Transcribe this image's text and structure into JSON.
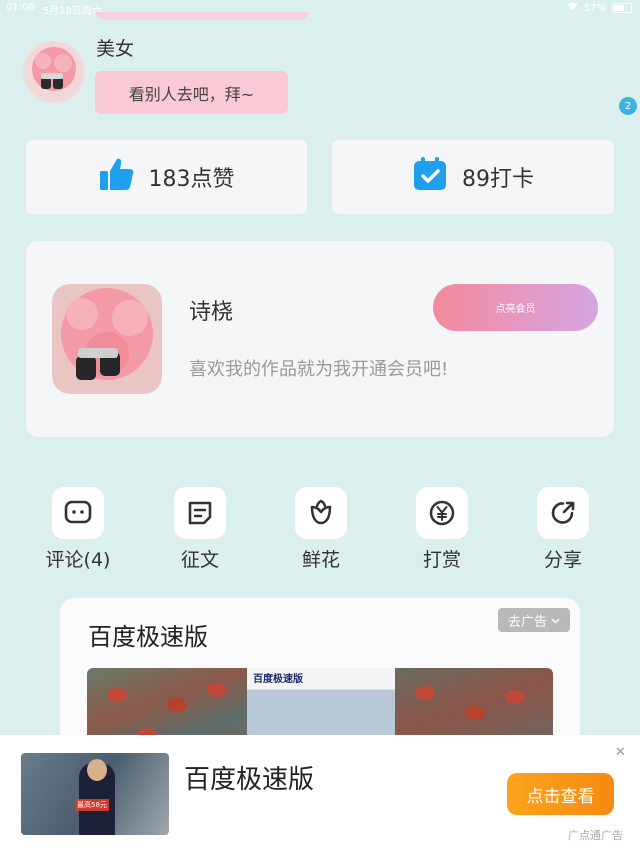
{
  "status_bar": {
    "time": "01:08",
    "date": "5月18日周六",
    "battery": "57%"
  },
  "comment": {
    "username": "美女",
    "message": "看别人去吧，拜~",
    "badge_count": "2"
  },
  "stats": {
    "likes": "183点赞",
    "checkins": "89打卡"
  },
  "vip_card": {
    "name": "诗桡",
    "description": "喜欢我的作品就为我开通会员吧!",
    "button_label": "点亮会员"
  },
  "actions": [
    {
      "label": "评论(4)",
      "icon": "comment-icon"
    },
    {
      "label": "征文",
      "icon": "essay-icon"
    },
    {
      "label": "鲜花",
      "icon": "flower-icon"
    },
    {
      "label": "打赏",
      "icon": "yen-icon"
    },
    {
      "label": "分享",
      "icon": "share-icon"
    }
  ],
  "ad_card": {
    "title": "百度极速版",
    "remove_label": "去广告",
    "image_brand": "百度极速版"
  },
  "bottom_banner": {
    "title": "百度极速版",
    "button_label": "点击查看",
    "source": "广点通广告",
    "thumb_tag": "最高58元"
  },
  "colors": {
    "background": "#dcefef",
    "like_icon": "#1ea0ef",
    "checkin_icon": "#1ea0ef",
    "vip_gradient_start": "#f48a9c",
    "vip_gradient_end": "#d6a5e2",
    "banner_button": "#f68a12"
  }
}
